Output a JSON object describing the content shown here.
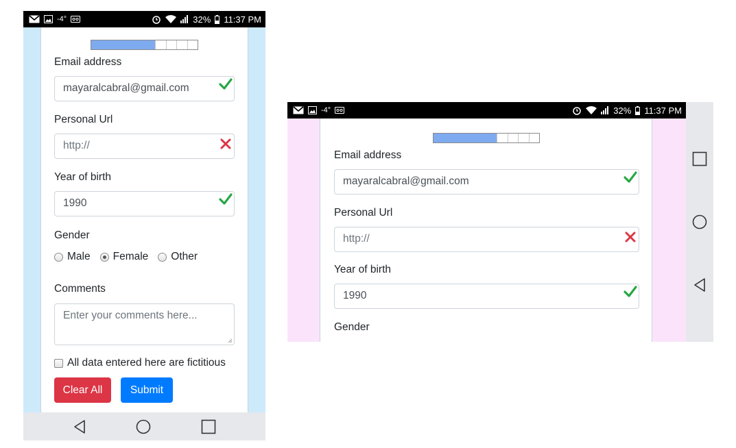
{
  "status_bar": {
    "temperature": "-4°",
    "battery": "32%",
    "time": "11:37 PM",
    "left_icons": [
      "gmail-icon",
      "image-icon",
      "weather-icon",
      "voicemail-icon"
    ],
    "right_icons": [
      "alarm-icon",
      "wifi-icon",
      "signal-icon",
      "battery-icon"
    ]
  },
  "progress": {
    "value": 0.6,
    "fill_color": "#7eaaf0"
  },
  "form": {
    "email": {
      "label": "Email address",
      "value": "mayaralcabral@gmail.com",
      "status": "valid"
    },
    "url": {
      "label": "Personal Url",
      "placeholder": "http://",
      "status": "invalid"
    },
    "year": {
      "label": "Year of birth",
      "value": "1990",
      "status": "valid"
    },
    "gender": {
      "label": "Gender",
      "options": [
        "Male",
        "Female",
        "Other"
      ],
      "selected": "Female"
    },
    "comments": {
      "label": "Comments",
      "placeholder": "Enter your comments here..."
    },
    "fictitious": {
      "label": "All data entered here are fictitious",
      "checked": false
    },
    "clear_label": "Clear All",
    "submit_label": "Submit"
  },
  "colors": {
    "portrait_side": "#cdeafb",
    "landscape_side": "#fbe4fb",
    "valid": "#28a745",
    "invalid": "#dc3545",
    "clear_button": "#dc3545",
    "submit_button": "#007bff"
  },
  "nav_buttons": [
    "back-icon",
    "home-icon",
    "recents-icon"
  ]
}
